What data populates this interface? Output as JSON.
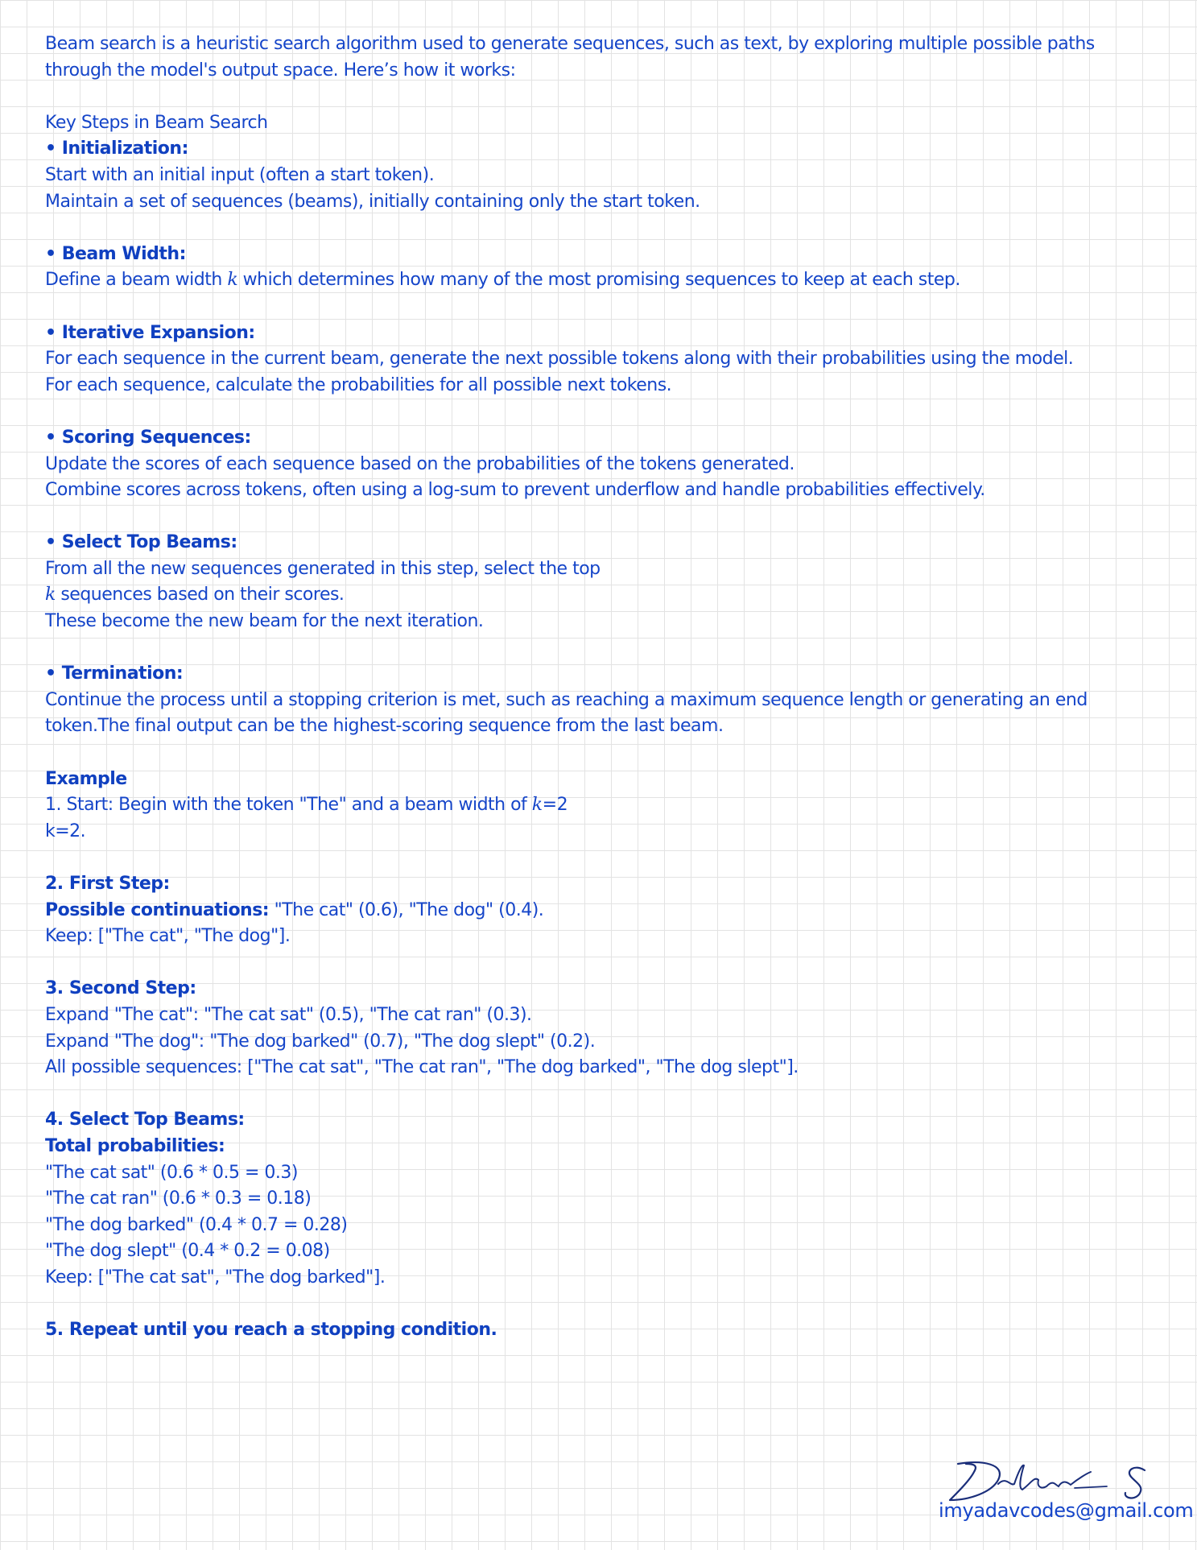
{
  "intro": {
    "line1": "Beam search is a heuristic search algorithm used to generate sequences, such as text, by exploring multiple possible paths",
    "line2": "through the model's output space. Here’s how it works:"
  },
  "key_steps": {
    "heading": "Key Steps in Beam Search",
    "initialization": {
      "title": "• Initialization:",
      "lines": [
        "Start with an initial input (often a start token).",
        "Maintain a set of sequences (beams), initially containing only the start token."
      ]
    },
    "beam_width": {
      "title": "• Beam Width:",
      "line_pre": "Define a beam width ",
      "line_k": "k",
      "line_post": " which determines how many of the most promising sequences to keep at each step."
    },
    "iterative_expansion": {
      "title": "• Iterative Expansion:",
      "lines": [
        "For each sequence in the current beam, generate the next possible tokens along with their probabilities using the model.",
        "For each sequence, calculate the probabilities for all possible next tokens."
      ]
    },
    "scoring": {
      "title": "• Scoring Sequences:",
      "lines": [
        "Update the scores of each sequence based on the probabilities of the tokens generated.",
        "Combine scores across tokens, often using a log-sum to prevent underflow and handle probabilities effectively."
      ]
    },
    "select_top": {
      "title": "• Select Top Beams:",
      "line1": "From all the new sequences generated in this step, select the top",
      "line2_k": "k",
      "line2_post": " sequences based on their scores.",
      "line3": "These become the new beam for the next iteration."
    },
    "termination": {
      "title": "• Termination:",
      "lines": [
        "Continue the process until a stopping criterion is met, such as reaching a maximum sequence length or generating an end",
        "token.The final output can be the highest-scoring sequence from the last beam."
      ]
    }
  },
  "example": {
    "heading": "Example",
    "step1": {
      "line1_pre": "1. Start: Begin with the token \"The\" and a beam width of ",
      "line1_k": "k",
      "line1_post": "=2",
      "line2": "k=2."
    },
    "step2": {
      "title": "2. First Step:",
      "label": "Possible continuations:",
      "value": " \"The cat\" (0.6), \"The dog\" (0.4).",
      "keep": "Keep: [\"The cat\", \"The dog\"]."
    },
    "step3": {
      "title": "3. Second Step:",
      "lines": [
        "Expand \"The cat\": \"The cat sat\" (0.5), \"The cat ran\" (0.3).",
        "Expand \"The dog\": \"The dog barked\" (0.7), \"The dog slept\" (0.2).",
        "All possible sequences: [\"The cat sat\", \"The cat ran\", \"The dog barked\", \"The dog slept\"]."
      ]
    },
    "step4": {
      "title": "4. Select Top Beams:",
      "subtitle": "Total probabilities:",
      "lines": [
        "\"The cat sat\" (0.6 * 0.5 = 0.3)",
        "\"The cat ran\" (0.6 * 0.3 = 0.18)",
        "\"The dog barked\" (0.4 * 0.7 = 0.28)",
        "\"The dog slept\" (0.4 * 0.2 = 0.08)",
        "Keep: [\"The cat sat\", \"The dog barked\"]."
      ]
    },
    "step5": {
      "title": "5. Repeat until you reach a stopping condition."
    }
  },
  "footer": {
    "signature": "Vithush S",
    "email": "imyadavcodes@gmail.com"
  }
}
